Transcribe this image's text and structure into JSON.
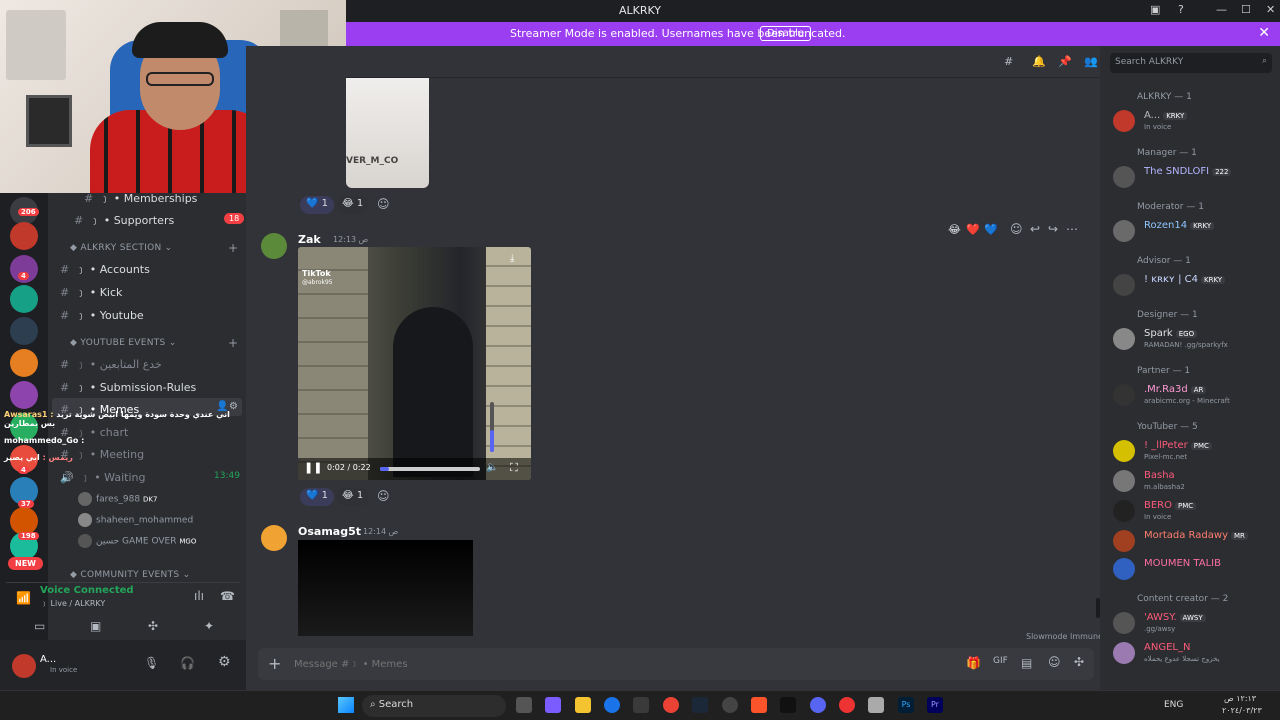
{
  "window": {
    "title": "ALKRKY"
  },
  "banner": {
    "message": "Streamer Mode is enabled. Usernames have been truncated.",
    "button": "Disable",
    "close": "✕"
  },
  "servers": {
    "badges": [
      "206",
      "4",
      "4",
      "37",
      "198"
    ],
    "new_label": "NEW",
    "colors": [
      "#3a3c42",
      "#c0392b",
      "#7d3c98",
      "#16a085",
      "#2c3e50",
      "#e67e22",
      "#8e44ad",
      "#27ae60",
      "#e74c3c",
      "#2980b9",
      "#d35400",
      "#1abc9c",
      "#c0392b",
      "#34495e"
    ]
  },
  "channels": {
    "memberships": "﹞ • Memberships",
    "supporters": "﹞ • Supporters",
    "supporters_badge": "18",
    "section1": "ALKRKY SECTION",
    "accounts": "﹞ • Accounts",
    "kick": "﹞ • Kick",
    "youtube": "﹞ • Youtube",
    "section2": "YOUTUBE EVENTS",
    "arabic_ch": "﹞ • خدع المتابعين",
    "submission": "﹞ • Submission-Rules",
    "memes": "﹞ • Memes",
    "chart": "﹞ • chart",
    "meeting": "﹞ • Meeting",
    "waiting": "﹞ • Waiting",
    "waiting_time": "13:49",
    "voice_users": [
      {
        "name": "fares_988",
        "tag": "DK7"
      },
      {
        "name": "shaheen_mohammed",
        "tag": ""
      },
      {
        "name": "حسين GAME OVER",
        "tag": "MGO"
      }
    ],
    "section3": "COMMUNITY EVENTS",
    "overlay_chat": [
      {
        "user": "Awsaras1 :",
        "text": "اني عندي وحدة سودة ويمها ابيض شوية تريد بس بمطارين"
      },
      {
        "user": "mohammedo_Go :",
        "text": ""
      },
      {
        "user": "ريمس :",
        "text": "ابي يصير"
      }
    ]
  },
  "voice": {
    "status": "Voice Connected",
    "location": "﹞ Live / ALKRKY"
  },
  "user": {
    "name": "A...",
    "status": "In voice"
  },
  "messages": [
    {
      "image_caption": "VER_M_CO",
      "reactions": [
        {
          "emoji": "💙",
          "count": "1"
        },
        {
          "emoji": "😂",
          "count": "1"
        }
      ]
    },
    {
      "author": "Zak",
      "time": "12:13 ص",
      "video_brand": "TikTok",
      "video_handle": "@abrok95",
      "video_time": "0:02 / 0:22",
      "video_progress": 0.09,
      "volume": 0.45,
      "reactions": [
        {
          "emoji": "💙",
          "count": "1"
        },
        {
          "emoji": "😂",
          "count": "1"
        }
      ]
    },
    {
      "author": "Osamag5t",
      "time": "12:14 ص"
    }
  ],
  "hover_reactions": [
    "😂",
    "❤️",
    "💙"
  ],
  "slowmode": "Slowmode Immune",
  "composer": {
    "placeholder": "Message #﹞ • Memes"
  },
  "members": {
    "search_placeholder": "Search ALKRKY",
    "groups": [
      {
        "cat": "ALKRKY — 1",
        "users": [
          {
            "name": "A...",
            "tag": "KRKY",
            "sub": "In voice",
            "color": "#b9bbbe",
            "av": "#c0392b"
          }
        ]
      },
      {
        "cat": "Manager — 1",
        "users": [
          {
            "name": "The SNDLOFI",
            "tag": "222",
            "sub": "",
            "color": "#b5b5ff",
            "av": "#555"
          }
        ]
      },
      {
        "cat": "Moderator — 1",
        "users": [
          {
            "name": "Rozen14",
            "tag": "KRKY",
            "sub": "",
            "color": "#8fc7ff",
            "av": "#6a6a6a"
          }
        ]
      },
      {
        "cat": "Advisor — 1",
        "users": [
          {
            "name": "! ᴋʀᴋʏ | C4",
            "tag": "KRKY",
            "sub": "",
            "color": "#c9d6ff",
            "av": "#444"
          }
        ]
      },
      {
        "cat": "Designer — 1",
        "users": [
          {
            "name": "Spark",
            "tag": "EGO",
            "sub": "RAMADAN! .gg/sparkyfx",
            "color": "#e0e0e0",
            "av": "#888"
          }
        ]
      },
      {
        "cat": "Partner — 1",
        "users": [
          {
            "name": ".Mr.Ra3d",
            "tag": "AR",
            "sub": "arabicmc.org - Minecraft",
            "color": "#ff9ad5",
            "av": "#333"
          }
        ]
      },
      {
        "cat": "YouTuber — 5",
        "users": [
          {
            "name": "! _llPeter",
            "tag": "PMC",
            "sub": "Pixel-mc.net",
            "color": "#ff5a7a",
            "av": "#d4c000"
          },
          {
            "name": "Basha",
            "tag": "",
            "sub": "m.albasha2",
            "color": "#ff5a7a",
            "av": "#777"
          },
          {
            "name": "BERO",
            "tag": "PMC",
            "sub": "In voice",
            "color": "#ff5a7a",
            "av": "#222"
          },
          {
            "name": "Mortada Radawy",
            "tag": "MR",
            "sub": "",
            "color": "#ff7e6e",
            "av": "#a04020"
          },
          {
            "name": "MOUMEN TALIB",
            "tag": "",
            "sub": "",
            "color": "#ff6fa0",
            "av": "#3060c0"
          }
        ]
      },
      {
        "cat": "Content creator — 2",
        "users": [
          {
            "name": "'AWSY.",
            "tag": "AWSY",
            "sub": ".gg/awsy",
            "color": "#ff5a7a",
            "av": "#555"
          },
          {
            "name": "ANGEL_N",
            "tag": "",
            "sub": "يخزوج تسجلا عدوع يحملاه",
            "color": "#ff5a7a",
            "av": "#9a7ab0"
          }
        ]
      }
    ]
  },
  "taskbar": {
    "search": "Search",
    "lang": "ENG",
    "time": "١٢:١٣ ص",
    "date": "٢٠٢٤/٠٣/٢٣"
  }
}
